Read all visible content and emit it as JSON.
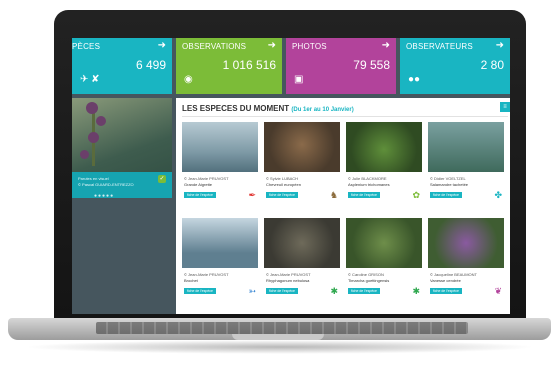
{
  "tiles": [
    {
      "name": "PÈCES",
      "value": "6 499",
      "icon": "bird-icons"
    },
    {
      "name": "OBSERVATIONS",
      "value": "1 016 516",
      "icon": "eye-icon"
    },
    {
      "name": "PHOTOS",
      "value": "79 558",
      "icon": "camera-icon"
    },
    {
      "name": "OBSERVATEURS",
      "value": "2 80",
      "icon": "users-icon"
    }
  ],
  "side": {
    "caption1": "Parutes en visuel",
    "caption2": "© Pascal GUIARD-ENTREZZO"
  },
  "section": {
    "title": "LES ESPECES DU MOMENT",
    "date": "(Du 1er au 10 Janvier)"
  },
  "cards": [
    {
      "author": "© Jean-Marie PRUVOST",
      "species": "Grande Aigrette",
      "fiche": "fiche de l'espèce",
      "group_icon": "feather-icon"
    },
    {
      "author": "© Sylvie LUBACH",
      "species": "Chevreuil européen",
      "fiche": "fiche de l'espèce",
      "group_icon": "mammal-icon"
    },
    {
      "author": "© Julie BLACKMORE",
      "species": "Asplenium trichomanes",
      "fiche": "fiche de l'espèce",
      "group_icon": "flower-icon"
    },
    {
      "author": "© Didier VOELTZEL",
      "species": "Salamandre tachetée",
      "fiche": "fiche de l'espèce",
      "group_icon": "amphibian-icon"
    },
    {
      "author": "© Jean-Marie PRUVOST",
      "species": "Brochet",
      "fiche": "fiche de l'espèce",
      "group_icon": "fish-icon"
    },
    {
      "author": "© Jean-Marie PRUVOST",
      "species": "Rhyphagonum nebulosa",
      "fiche": "fiche de l'espèce",
      "group_icon": "insect-icon"
    },
    {
      "author": "© Caroline GRISON",
      "species": "Timarcha goettingensis",
      "fiche": "fiche de l'espèce",
      "group_icon": "insect-icon"
    },
    {
      "author": "© Jacqueline BEAUMONT",
      "species": "Vanesse cendrée",
      "fiche": "fiche de l'espèce",
      "group_icon": "butterfly-icon"
    }
  ],
  "colors": {
    "teal": "#19b5c2",
    "green": "#7cbc38",
    "purple": "#b2439b",
    "panel": "#46565e"
  }
}
